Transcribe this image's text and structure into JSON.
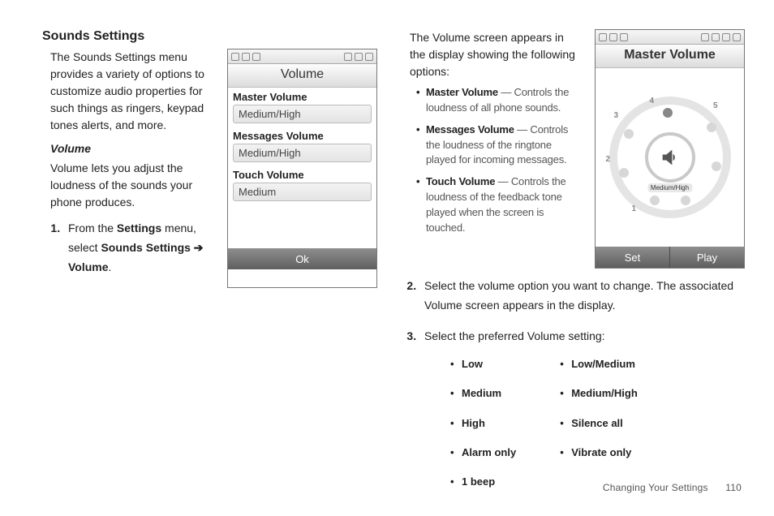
{
  "left": {
    "heading": "Sounds Settings",
    "intro": "The Sounds Settings menu provides a variety of options to customize audio properties for such things as ringers, keypad tones alerts, and more.",
    "subheading": "Volume",
    "sub_desc": "Volume lets you adjust the loudness of the sounds your phone produces.",
    "step1_pre": "From the ",
    "step1_b1": "Settings",
    "step1_mid": " menu, select ",
    "step1_b2": "Sounds Settings",
    "step1_arrow": " ➔ ",
    "step1_b3": "Volume",
    "step1_post": "."
  },
  "phone1": {
    "title": "Volume",
    "softkey": "Ok",
    "rows": [
      {
        "label": "Master Volume",
        "value": "Medium/High"
      },
      {
        "label": "Messages Volume",
        "value": "Medium/High"
      },
      {
        "label": "Touch Volume",
        "value": "Medium"
      }
    ]
  },
  "right": {
    "lead": "The Volume screen appears in the display showing the following options:",
    "items": [
      {
        "term": "Master Volume",
        "desc": " — Controls the loudness of all phone sounds."
      },
      {
        "term": "Messages Volume",
        "desc": " — Controls the loudness of the ringtone played for incoming messages."
      },
      {
        "term": "Touch Volume",
        "desc": " — Controls the loudness of the feedback tone played when the screen is touched."
      }
    ],
    "step2": "Select the volume option you want to change. The associated Volume screen appears in the display.",
    "step3": "Select the preferred Volume setting:",
    "levels_a": [
      "Low",
      "Medium",
      "High",
      "Alarm only",
      "1 beep"
    ],
    "levels_b": [
      "Low/Medium",
      "Medium/High",
      "Silence all",
      "Vibrate only"
    ]
  },
  "phone2": {
    "title": "Master Volume",
    "level_label": "Medium/High",
    "sk_left": "Set",
    "sk_right": "Play",
    "numbers": [
      "1",
      "2",
      "3",
      "4",
      "5"
    ]
  },
  "footer": {
    "section": "Changing Your Settings",
    "page": "110"
  }
}
